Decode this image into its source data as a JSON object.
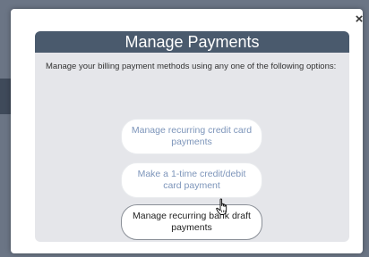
{
  "dialog": {
    "close_label": "×",
    "title": "Manage Payments",
    "description": "Manage your billing payment methods using any one of the following options:",
    "options": [
      {
        "label": "Manage recurring credit card payments",
        "state": "disabled"
      },
      {
        "label": "Make a 1-time credit/debit card payment",
        "state": "disabled"
      },
      {
        "label": "Manage recurring bank draft payments",
        "state": "hovered"
      }
    ]
  },
  "icons": {
    "close": "close-icon",
    "cursor": "hand-pointer-icon"
  },
  "colors": {
    "header_bg": "#4a5a6d",
    "card_bg": "#e5e6ea",
    "disabled_text": "#7d95ba"
  }
}
